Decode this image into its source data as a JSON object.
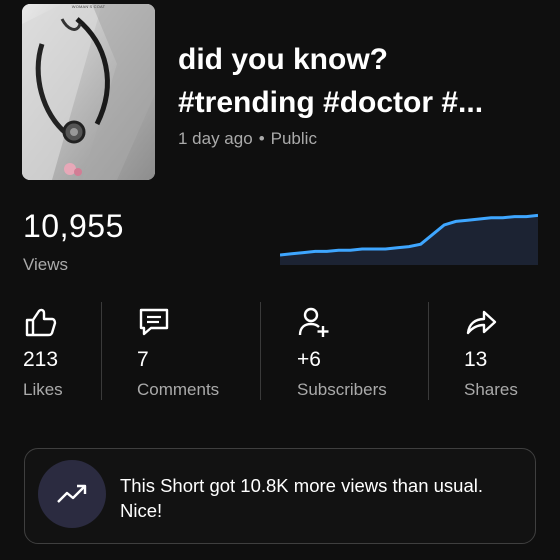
{
  "thumbnail": {
    "icon": "stethoscope-photo",
    "caption": "WOMAN'S COAT"
  },
  "video": {
    "title_line1": "did you know?",
    "title_line2": "#trending #doctor #...",
    "age": "1 day ago",
    "separator": "•",
    "visibility": "Public"
  },
  "views": {
    "count": "10,955",
    "label": "Views"
  },
  "sparkline": {
    "color": "#3ea6ff",
    "fill": "#1c2333",
    "values": [
      5,
      6,
      7,
      8,
      8,
      9,
      9,
      10,
      10,
      10,
      11,
      12,
      14,
      22,
      30,
      33,
      34,
      35,
      36,
      36,
      37,
      37,
      38
    ]
  },
  "stats": [
    {
      "icon": "thumbs-up-icon",
      "value": "213",
      "label": "Likes"
    },
    {
      "icon": "comment-icon",
      "value": "7",
      "label": "Comments"
    },
    {
      "icon": "add-person-icon",
      "value": "+6",
      "label": "Subscribers"
    },
    {
      "icon": "share-arrow-icon",
      "value": "13",
      "label": "Shares"
    }
  ],
  "insight": {
    "icon": "trending-up-icon",
    "message": "This Short got 10.8K more views than usual. Nice!"
  }
}
